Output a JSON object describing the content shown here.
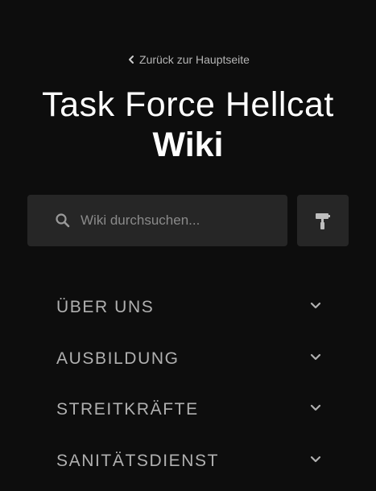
{
  "back_link": {
    "label": "Zurück zur Hauptseite",
    "icon": "chevron-left-icon"
  },
  "header": {
    "title": "Task Force Hellcat",
    "subtitle": "Wiki"
  },
  "search": {
    "placeholder": "Wiki durchsuchen...",
    "value": "",
    "icon": "search-icon"
  },
  "theme_button": {
    "icon": "paint-roller-icon"
  },
  "nav": {
    "items": [
      {
        "label": "ÜBER UNS"
      },
      {
        "label": "AUSBILDUNG"
      },
      {
        "label": "STREITKRÄFTE"
      },
      {
        "label": "SANITÄTSDIENST"
      }
    ]
  },
  "colors": {
    "background": "#0d0d0d",
    "surface": "#262626",
    "text_primary": "#ffffff",
    "text_muted": "#b0b0b0"
  }
}
